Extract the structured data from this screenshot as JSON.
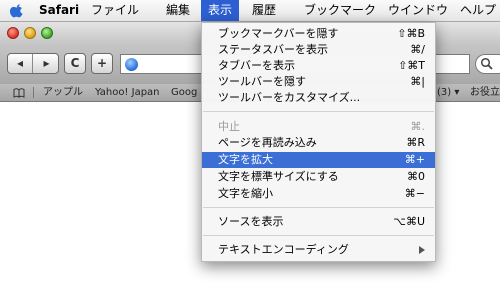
{
  "menubar": {
    "app": "Safari",
    "items": [
      "ファイル",
      "編集",
      "表示",
      "履歴",
      "ブックマーク",
      "ウインドウ",
      "ヘルプ"
    ],
    "active_index": 2
  },
  "toolbar": {
    "back": "◂",
    "forward": "▸",
    "reload": "C",
    "add": "+",
    "search_icon": "magnifier-icon"
  },
  "bookmarks": {
    "items": [
      "アップル",
      "Yahoo! Japan",
      "Goog",
      "(3) ▾",
      "お役立ち"
    ]
  },
  "view_menu": {
    "items": [
      {
        "label": "ブックマークバーを隠す",
        "shortcut": "⇧⌘B"
      },
      {
        "label": "ステータスバーを表示",
        "shortcut": "⌘/"
      },
      {
        "label": "タブバーを表示",
        "shortcut": "⇧⌘T"
      },
      {
        "label": "ツールバーを隠す",
        "shortcut": "⌘|"
      },
      {
        "label": "ツールバーをカスタマイズ...",
        "shortcut": ""
      },
      {
        "label": "中止",
        "shortcut": "⌘.",
        "disabled": true
      },
      {
        "label": "ページを再読み込み",
        "shortcut": "⌘R"
      },
      {
        "label": "文字を拡大",
        "shortcut": "⌘+",
        "highlighted": true
      },
      {
        "label": "文字を標準サイズにする",
        "shortcut": "⌘0"
      },
      {
        "label": "文字を縮小",
        "shortcut": "⌘−"
      },
      {
        "label": "ソースを表示",
        "shortcut": "⌥⌘U"
      },
      {
        "label": "テキストエンコーディング",
        "shortcut": "",
        "submenu": true
      }
    ]
  },
  "colors": {
    "highlight": "#3b6fd6",
    "menubar_active": "#2c5fd1",
    "disabled_text": "#9a9a9a"
  }
}
